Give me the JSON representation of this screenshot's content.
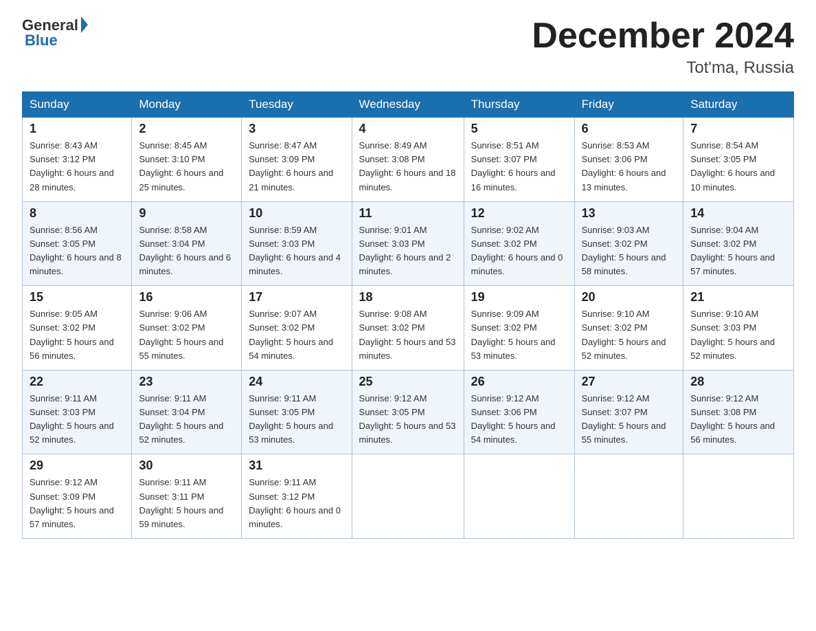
{
  "header": {
    "logo_general": "General",
    "logo_blue": "Blue",
    "month": "December 2024",
    "location": "Tot'ma, Russia"
  },
  "weekdays": [
    "Sunday",
    "Monday",
    "Tuesday",
    "Wednesday",
    "Thursday",
    "Friday",
    "Saturday"
  ],
  "weeks": [
    [
      {
        "day": "1",
        "sunrise": "8:43 AM",
        "sunset": "3:12 PM",
        "daylight": "6 hours and 28 minutes."
      },
      {
        "day": "2",
        "sunrise": "8:45 AM",
        "sunset": "3:10 PM",
        "daylight": "6 hours and 25 minutes."
      },
      {
        "day": "3",
        "sunrise": "8:47 AM",
        "sunset": "3:09 PM",
        "daylight": "6 hours and 21 minutes."
      },
      {
        "day": "4",
        "sunrise": "8:49 AM",
        "sunset": "3:08 PM",
        "daylight": "6 hours and 18 minutes."
      },
      {
        "day": "5",
        "sunrise": "8:51 AM",
        "sunset": "3:07 PM",
        "daylight": "6 hours and 16 minutes."
      },
      {
        "day": "6",
        "sunrise": "8:53 AM",
        "sunset": "3:06 PM",
        "daylight": "6 hours and 13 minutes."
      },
      {
        "day": "7",
        "sunrise": "8:54 AM",
        "sunset": "3:05 PM",
        "daylight": "6 hours and 10 minutes."
      }
    ],
    [
      {
        "day": "8",
        "sunrise": "8:56 AM",
        "sunset": "3:05 PM",
        "daylight": "6 hours and 8 minutes."
      },
      {
        "day": "9",
        "sunrise": "8:58 AM",
        "sunset": "3:04 PM",
        "daylight": "6 hours and 6 minutes."
      },
      {
        "day": "10",
        "sunrise": "8:59 AM",
        "sunset": "3:03 PM",
        "daylight": "6 hours and 4 minutes."
      },
      {
        "day": "11",
        "sunrise": "9:01 AM",
        "sunset": "3:03 PM",
        "daylight": "6 hours and 2 minutes."
      },
      {
        "day": "12",
        "sunrise": "9:02 AM",
        "sunset": "3:02 PM",
        "daylight": "6 hours and 0 minutes."
      },
      {
        "day": "13",
        "sunrise": "9:03 AM",
        "sunset": "3:02 PM",
        "daylight": "5 hours and 58 minutes."
      },
      {
        "day": "14",
        "sunrise": "9:04 AM",
        "sunset": "3:02 PM",
        "daylight": "5 hours and 57 minutes."
      }
    ],
    [
      {
        "day": "15",
        "sunrise": "9:05 AM",
        "sunset": "3:02 PM",
        "daylight": "5 hours and 56 minutes."
      },
      {
        "day": "16",
        "sunrise": "9:06 AM",
        "sunset": "3:02 PM",
        "daylight": "5 hours and 55 minutes."
      },
      {
        "day": "17",
        "sunrise": "9:07 AM",
        "sunset": "3:02 PM",
        "daylight": "5 hours and 54 minutes."
      },
      {
        "day": "18",
        "sunrise": "9:08 AM",
        "sunset": "3:02 PM",
        "daylight": "5 hours and 53 minutes."
      },
      {
        "day": "19",
        "sunrise": "9:09 AM",
        "sunset": "3:02 PM",
        "daylight": "5 hours and 53 minutes."
      },
      {
        "day": "20",
        "sunrise": "9:10 AM",
        "sunset": "3:02 PM",
        "daylight": "5 hours and 52 minutes."
      },
      {
        "day": "21",
        "sunrise": "9:10 AM",
        "sunset": "3:03 PM",
        "daylight": "5 hours and 52 minutes."
      }
    ],
    [
      {
        "day": "22",
        "sunrise": "9:11 AM",
        "sunset": "3:03 PM",
        "daylight": "5 hours and 52 minutes."
      },
      {
        "day": "23",
        "sunrise": "9:11 AM",
        "sunset": "3:04 PM",
        "daylight": "5 hours and 52 minutes."
      },
      {
        "day": "24",
        "sunrise": "9:11 AM",
        "sunset": "3:05 PM",
        "daylight": "5 hours and 53 minutes."
      },
      {
        "day": "25",
        "sunrise": "9:12 AM",
        "sunset": "3:05 PM",
        "daylight": "5 hours and 53 minutes."
      },
      {
        "day": "26",
        "sunrise": "9:12 AM",
        "sunset": "3:06 PM",
        "daylight": "5 hours and 54 minutes."
      },
      {
        "day": "27",
        "sunrise": "9:12 AM",
        "sunset": "3:07 PM",
        "daylight": "5 hours and 55 minutes."
      },
      {
        "day": "28",
        "sunrise": "9:12 AM",
        "sunset": "3:08 PM",
        "daylight": "5 hours and 56 minutes."
      }
    ],
    [
      {
        "day": "29",
        "sunrise": "9:12 AM",
        "sunset": "3:09 PM",
        "daylight": "5 hours and 57 minutes."
      },
      {
        "day": "30",
        "sunrise": "9:11 AM",
        "sunset": "3:11 PM",
        "daylight": "5 hours and 59 minutes."
      },
      {
        "day": "31",
        "sunrise": "9:11 AM",
        "sunset": "3:12 PM",
        "daylight": "6 hours and 0 minutes."
      },
      null,
      null,
      null,
      null
    ]
  ],
  "labels": {
    "sunrise": "Sunrise:",
    "sunset": "Sunset:",
    "daylight": "Daylight:"
  }
}
